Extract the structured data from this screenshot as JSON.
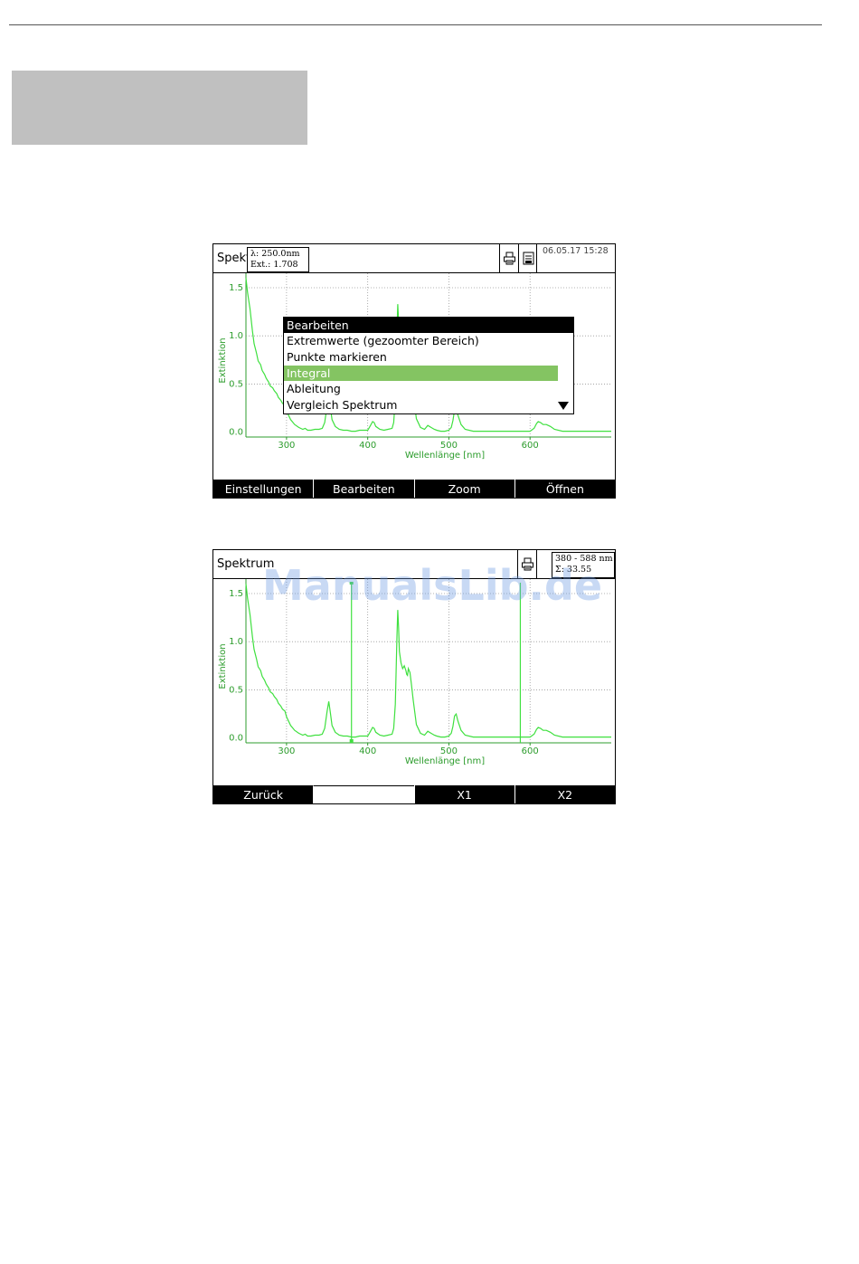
{
  "screen1": {
    "title": "Spekt",
    "tooltip": {
      "line1": "λ: 250.0nm",
      "line2": "Ext.: 1.708"
    },
    "datetime": "06.05.17 15:28",
    "menu": {
      "header": "Bearbeiten",
      "items": [
        {
          "label": "Extremwerte (gezoomter Bereich)",
          "selected": false
        },
        {
          "label": "Punkte markieren",
          "selected": false
        },
        {
          "label": "Integral",
          "selected": true
        },
        {
          "label": "Ableitung",
          "selected": false
        },
        {
          "label": "Vergleich Spektrum",
          "selected": false
        }
      ]
    },
    "softkeys": [
      "Einstellungen",
      "Bearbeiten",
      "Zoom",
      "Öffnen"
    ]
  },
  "screen2": {
    "title": "Spektrum",
    "tooltip": {
      "line1": "380 - 588 nm",
      "line2": "Σ: 33.55"
    },
    "softkeys": [
      "Zurück",
      "",
      "X1",
      "X2"
    ],
    "markers_nm": [
      380,
      588
    ]
  },
  "watermark": "ManualsLib.de",
  "colors": {
    "curve": "#3fe03f",
    "label": "#2c9c2c",
    "selected": "#84c462"
  },
  "chart_data": [
    {
      "type": "line",
      "xlabel": "Wellenlänge [nm]",
      "ylabel": "Extinktion",
      "x_ticks": [
        300,
        400,
        500,
        600
      ],
      "y_ticks": [
        0.0,
        0.5,
        1.0,
        1.5
      ],
      "y_tick_labels": [
        "0.0",
        "0.5",
        "1.0",
        "1.5"
      ],
      "xlim": [
        250,
        700
      ],
      "ylim": [
        -0.05,
        1.65
      ],
      "grid": true,
      "series": [
        {
          "x": [
            250,
            252,
            255,
            258,
            260,
            263,
            265,
            268,
            270,
            273,
            275,
            278,
            280,
            283,
            285,
            288,
            290,
            293,
            295,
            298,
            300,
            305,
            310,
            315,
            320,
            323,
            326,
            330,
            335,
            340,
            344,
            347,
            350,
            352,
            354,
            356,
            360,
            365,
            370,
            375,
            380,
            385,
            390,
            395,
            400,
            402,
            404,
            406,
            408,
            410,
            415,
            420,
            425,
            430,
            432,
            434,
            436,
            437,
            438,
            439,
            441,
            443,
            445,
            447,
            448,
            449,
            450,
            452,
            454,
            456,
            460,
            465,
            470,
            472,
            474,
            478,
            482,
            485,
            490,
            495,
            500,
            503,
            505,
            507,
            509,
            511,
            515,
            520,
            530,
            540,
            550,
            560,
            570,
            580,
            590,
            600,
            605,
            608,
            610,
            613,
            616,
            620,
            625,
            630,
            640,
            650,
            660,
            675,
            690,
            700
          ],
          "y": [
            1.6,
            1.45,
            1.28,
            1.05,
            0.92,
            0.82,
            0.74,
            0.7,
            0.64,
            0.6,
            0.56,
            0.52,
            0.48,
            0.46,
            0.43,
            0.4,
            0.36,
            0.33,
            0.3,
            0.28,
            0.22,
            0.13,
            0.08,
            0.05,
            0.03,
            0.04,
            0.02,
            0.02,
            0.03,
            0.03,
            0.04,
            0.1,
            0.28,
            0.38,
            0.26,
            0.13,
            0.06,
            0.03,
            0.02,
            0.02,
            0.01,
            0.01,
            0.02,
            0.02,
            0.02,
            0.05,
            0.08,
            0.11,
            0.1,
            0.06,
            0.03,
            0.02,
            0.03,
            0.04,
            0.1,
            0.35,
            1.05,
            1.33,
            1.15,
            0.9,
            0.78,
            0.72,
            0.75,
            0.7,
            0.66,
            0.65,
            0.72,
            0.68,
            0.55,
            0.4,
            0.14,
            0.05,
            0.03,
            0.05,
            0.07,
            0.05,
            0.03,
            0.02,
            0.01,
            0.01,
            0.02,
            0.05,
            0.12,
            0.23,
            0.25,
            0.18,
            0.08,
            0.03,
            0.01,
            0.01,
            0.01,
            0.01,
            0.01,
            0.01,
            0.01,
            0.01,
            0.04,
            0.09,
            0.11,
            0.1,
            0.08,
            0.08,
            0.06,
            0.03,
            0.01,
            0.01,
            0.01,
            0.01,
            0.01,
            0.01
          ]
        }
      ]
    }
  ]
}
